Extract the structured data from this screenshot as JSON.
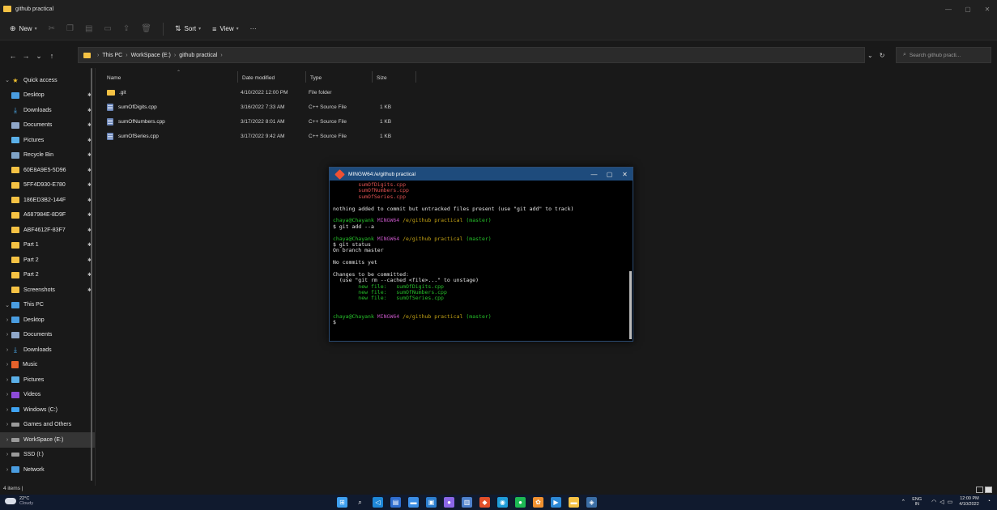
{
  "window": {
    "title": "github practical",
    "controls": [
      "—",
      "▢",
      "✕"
    ]
  },
  "commandbar": {
    "new_label": "New",
    "sort_label": "Sort",
    "view_label": "View",
    "more_label": "···"
  },
  "address": {
    "crumbs": [
      "This PC",
      "WorkSpace (E:)",
      "github practical"
    ],
    "search_placeholder": "Search github practi..."
  },
  "sidebar": {
    "quick_access": "Quick access",
    "pinned": [
      {
        "label": "Desktop",
        "icon": "desktop-icon"
      },
      {
        "label": "Downloads",
        "icon": "download-icon"
      },
      {
        "label": "Documents",
        "icon": "documents-icon"
      },
      {
        "label": "Pictures",
        "icon": "pictures-icon"
      },
      {
        "label": "Recycle Bin",
        "icon": "recycle-bin-icon"
      },
      {
        "label": "60E8A9E5-5D96",
        "icon": "folder-icon"
      },
      {
        "label": "5FF4D930-E780",
        "icon": "folder-icon"
      },
      {
        "label": "186ED3B2-144F",
        "icon": "folder-icon"
      },
      {
        "label": "A687984E-8D9F",
        "icon": "folder-icon"
      },
      {
        "label": "ABF4612F-83F7",
        "icon": "folder-icon"
      },
      {
        "label": "Part 1",
        "icon": "folder-icon"
      },
      {
        "label": "Part 2",
        "icon": "folder-icon"
      },
      {
        "label": "Part 2",
        "icon": "folder-icon"
      },
      {
        "label": "Screenshots",
        "icon": "folder-icon"
      }
    ],
    "this_pc": "This PC",
    "pc_items": [
      {
        "label": "Desktop"
      },
      {
        "label": "Documents"
      },
      {
        "label": "Downloads"
      },
      {
        "label": "Music"
      },
      {
        "label": "Pictures"
      },
      {
        "label": "Videos"
      },
      {
        "label": "Windows (C:)"
      },
      {
        "label": "Games and Others"
      },
      {
        "label": "WorkSpace (E:)"
      },
      {
        "label": "SSD (I:)"
      }
    ],
    "network": "Network"
  },
  "columns": {
    "name": "Name",
    "date": "Date modified",
    "type": "Type",
    "size": "Size"
  },
  "files": [
    {
      "name": ".git",
      "date": "4/10/2022 12:00 PM",
      "type": "File folder",
      "size": "",
      "kind": "folder"
    },
    {
      "name": "sumOfDigits.cpp",
      "date": "3/16/2022 7:33 AM",
      "type": "C++ Source File",
      "size": "1 KB",
      "kind": "cpp"
    },
    {
      "name": "sumOfNumbers.cpp",
      "date": "3/17/2022 8:01 AM",
      "type": "C++ Source File",
      "size": "1 KB",
      "kind": "cpp"
    },
    {
      "name": "sumOfSeries.cpp",
      "date": "3/17/2022 9:42 AM",
      "type": "C++ Source File",
      "size": "1 KB",
      "kind": "cpp"
    }
  ],
  "status": {
    "items_count": "4 items"
  },
  "terminal": {
    "title": "MINGW64:/e/github practical",
    "lines": [
      [
        {
          "t": "        sumOfDigits.cpp",
          "c": "red"
        }
      ],
      [
        {
          "t": "        sumOfNumbers.cpp",
          "c": "red"
        }
      ],
      [
        {
          "t": "        sumOfSeries.cpp",
          "c": "red"
        }
      ],
      [
        {
          "t": "",
          "c": "white"
        }
      ],
      [
        {
          "t": "nothing added to commit but untracked files present (use \"git add\" to track)",
          "c": "white"
        }
      ],
      [
        {
          "t": "",
          "c": "white"
        }
      ],
      [
        {
          "t": "chaya@Chayank ",
          "c": "green"
        },
        {
          "t": "MINGW64 ",
          "c": "magenta"
        },
        {
          "t": "/e/github practical ",
          "c": "yellow"
        },
        {
          "t": "(master)",
          "c": "green"
        }
      ],
      [
        {
          "t": "$ git add --a",
          "c": "white"
        }
      ],
      [
        {
          "t": "",
          "c": "white"
        }
      ],
      [
        {
          "t": "chaya@Chayank ",
          "c": "green"
        },
        {
          "t": "MINGW64 ",
          "c": "magenta"
        },
        {
          "t": "/e/github practical ",
          "c": "yellow"
        },
        {
          "t": "(master)",
          "c": "green"
        }
      ],
      [
        {
          "t": "$ git status",
          "c": "white"
        }
      ],
      [
        {
          "t": "On branch master",
          "c": "white"
        }
      ],
      [
        {
          "t": "",
          "c": "white"
        }
      ],
      [
        {
          "t": "No commits yet",
          "c": "white"
        }
      ],
      [
        {
          "t": "",
          "c": "white"
        }
      ],
      [
        {
          "t": "Changes to be committed:",
          "c": "white"
        }
      ],
      [
        {
          "t": "  (use \"git rm --cached <file>...\" to unstage)",
          "c": "white"
        }
      ],
      [
        {
          "t": "        new file:   sumOfDigits.cpp",
          "c": "green"
        }
      ],
      [
        {
          "t": "        new file:   sumOfNumbers.cpp",
          "c": "green"
        }
      ],
      [
        {
          "t": "        new file:   sumOfSeries.cpp",
          "c": "green"
        }
      ],
      [
        {
          "t": "",
          "c": "white"
        }
      ],
      [
        {
          "t": "",
          "c": "white"
        }
      ],
      [
        {
          "t": "chaya@Chayank ",
          "c": "green"
        },
        {
          "t": "MINGW64 ",
          "c": "magenta"
        },
        {
          "t": "/e/github practical ",
          "c": "yellow"
        },
        {
          "t": "(master)",
          "c": "green"
        }
      ],
      [
        {
          "t": "$",
          "c": "white"
        }
      ]
    ]
  },
  "taskbar": {
    "temperature": "22°C",
    "condition": "Cloudy",
    "lang": "ENG",
    "region": "IN",
    "time": "12:00 PM",
    "date": "4/10/2022",
    "apps": [
      {
        "icon": "start-icon",
        "color": "#3ea0f0",
        "glyph": "⊞"
      },
      {
        "icon": "search-icon",
        "color": "transparent",
        "glyph": "⌕"
      },
      {
        "icon": "vscode-icon",
        "color": "#1e88d8",
        "glyph": "◁"
      },
      {
        "icon": "app-icon",
        "color": "#2f6ed0",
        "glyph": "▤"
      },
      {
        "icon": "app-icon-2",
        "color": "#3b8ee6",
        "glyph": "▬"
      },
      {
        "icon": "app-icon-3",
        "color": "#2c7fd0",
        "glyph": "▣"
      },
      {
        "icon": "chat-icon",
        "color": "#8a66e8",
        "glyph": "●"
      },
      {
        "icon": "app-icon-4",
        "color": "#4d80cc",
        "glyph": "▥"
      },
      {
        "icon": "brave-icon",
        "color": "#e2502a",
        "glyph": "◆"
      },
      {
        "icon": "chrome-icon",
        "color": "#1f9dd9",
        "glyph": "◉"
      },
      {
        "icon": "spotify-icon",
        "color": "#1db954",
        "glyph": "●"
      },
      {
        "icon": "app-icon-5",
        "color": "#f09030",
        "glyph": "✿"
      },
      {
        "icon": "app-icon-6",
        "color": "#2d8ad8",
        "glyph": "▶"
      },
      {
        "icon": "file-explorer-icon",
        "color": "#f5c244",
        "glyph": "▬"
      },
      {
        "icon": "git-bash-icon",
        "color": "#3b6ea5",
        "glyph": "◈"
      }
    ]
  }
}
